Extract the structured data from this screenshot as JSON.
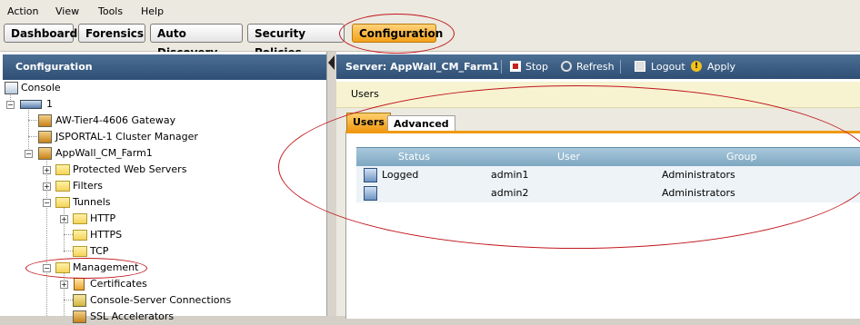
{
  "menu": [
    {
      "label": "Action",
      "mnemonic": "A"
    },
    {
      "label": "View",
      "mnemonic": "V"
    },
    {
      "label": "Tools",
      "mnemonic": "T"
    },
    {
      "label": "Help",
      "mnemonic": "H"
    }
  ],
  "nav_tabs": [
    {
      "label": "Dashboard"
    },
    {
      "label": "Forensics"
    },
    {
      "label": "Auto Discovery"
    },
    {
      "label": "Security Policies"
    },
    {
      "label": "Configuration",
      "active": true
    }
  ],
  "left_panel": {
    "title": "Configuration",
    "tree": [
      {
        "label": "Console",
        "icon": "console-icon"
      },
      {
        "label": "1",
        "icon": "network-icon",
        "expander": "minus"
      },
      {
        "label": "AW-Tier4-4606 Gateway",
        "icon": "gateway-icon"
      },
      {
        "label": "JSPORTAL-1 Cluster Manager",
        "icon": "cluster-manager-icon"
      },
      {
        "label": "AppWall_CM_Farm1",
        "icon": "farm-icon",
        "expander": "minus"
      },
      {
        "label": "Protected Web Servers",
        "icon": "folder-icon",
        "expander": "plus"
      },
      {
        "label": "Filters",
        "icon": "folder-icon",
        "expander": "plus"
      },
      {
        "label": "Tunnels",
        "icon": "folder-icon",
        "expander": "minus"
      },
      {
        "label": "HTTP",
        "icon": "folder-icon",
        "expander": "plus"
      },
      {
        "label": "HTTPS",
        "icon": "folder-icon"
      },
      {
        "label": "TCP",
        "icon": "folder-icon"
      },
      {
        "label": "Management",
        "icon": "folder-open-icon",
        "expander": "minus"
      },
      {
        "label": "Certificates",
        "icon": "certificate-icon",
        "expander": "plus"
      },
      {
        "label": "Console-Server Connections",
        "icon": "connections-icon"
      },
      {
        "label": "SSL Accelerators",
        "icon": "accelerator-icon"
      }
    ]
  },
  "server_bar": {
    "title": "Server: AppWall_CM_Farm1",
    "stop": "Stop",
    "refresh": "Refresh",
    "logout": "Logout",
    "apply": "Apply Changes"
  },
  "breadcrumb": "Users",
  "content_tabs": [
    {
      "label": "Users",
      "active": true
    },
    {
      "label": "Advanced"
    }
  ],
  "users_table": {
    "columns": [
      "Status",
      "User",
      "Group"
    ],
    "rows": [
      {
        "status": "Logged",
        "user": "admin1",
        "group": "Administrators"
      },
      {
        "status": "",
        "user": "admin2",
        "group": "Administrators"
      }
    ]
  },
  "colors": {
    "accent": "#f09a14",
    "header_bar": "#2f4f75",
    "annotation": "#c0161c"
  }
}
